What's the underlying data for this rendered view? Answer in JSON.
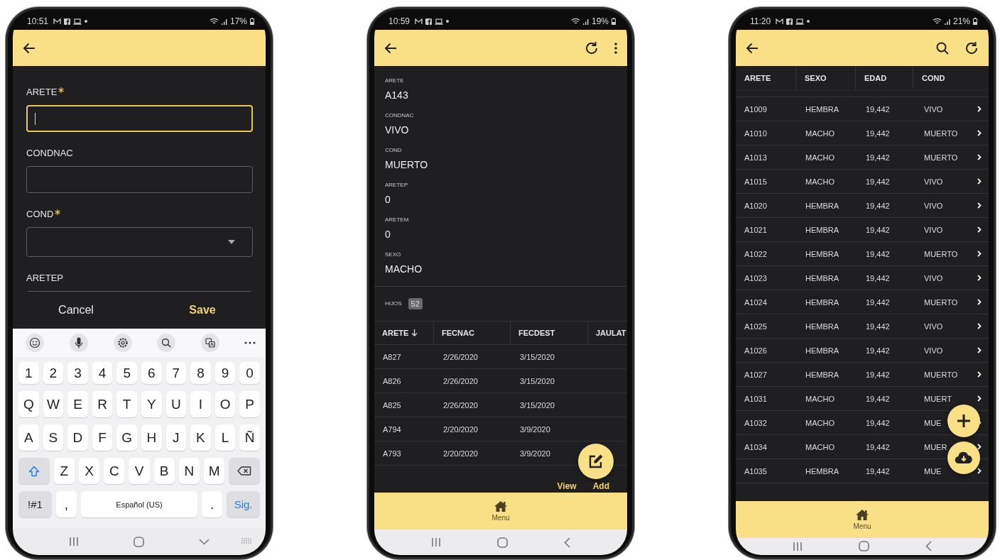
{
  "screens": [
    {
      "kind": "form",
      "status_bar": {
        "time": "10:51",
        "battery": "17%"
      },
      "fields": [
        {
          "label": "ARETE",
          "required": true,
          "kind": "text",
          "focused": true
        },
        {
          "label": "CONDNAC",
          "required": false,
          "kind": "text",
          "focused": false
        },
        {
          "label": "COND",
          "required": true,
          "kind": "select",
          "focused": false
        },
        {
          "label": "ARETEP",
          "required": false,
          "kind": "text",
          "focused": false
        }
      ],
      "actions": [
        {
          "label": "Cancel",
          "kind": "plain"
        },
        {
          "label": "Save",
          "kind": "primary"
        }
      ],
      "keyboard": {
        "number_keys": [
          {
            "label": "1",
            "kind": "char"
          },
          {
            "label": "2",
            "kind": "char"
          },
          {
            "label": "3",
            "kind": "char"
          },
          {
            "label": "4",
            "kind": "char"
          },
          {
            "label": "5",
            "kind": "char"
          },
          {
            "label": "6",
            "kind": "char"
          },
          {
            "label": "7",
            "kind": "char"
          },
          {
            "label": "8",
            "kind": "char"
          },
          {
            "label": "9",
            "kind": "char"
          },
          {
            "label": "0",
            "kind": "char"
          }
        ],
        "letter_rows": [
          [
            {
              "label": "Q",
              "kind": "char"
            },
            {
              "label": "W",
              "kind": "char"
            },
            {
              "label": "E",
              "kind": "char"
            },
            {
              "label": "R",
              "kind": "char"
            },
            {
              "label": "T",
              "kind": "char"
            },
            {
              "label": "Y",
              "kind": "char"
            },
            {
              "label": "U",
              "kind": "char"
            },
            {
              "label": "I",
              "kind": "char"
            },
            {
              "label": "O",
              "kind": "char"
            },
            {
              "label": "P",
              "kind": "char"
            }
          ],
          [
            {
              "label": "A",
              "kind": "char"
            },
            {
              "label": "S",
              "kind": "char"
            },
            {
              "label": "D",
              "kind": "char"
            },
            {
              "label": "F",
              "kind": "char"
            },
            {
              "label": "G",
              "kind": "char"
            },
            {
              "label": "H",
              "kind": "char"
            },
            {
              "label": "J",
              "kind": "char"
            },
            {
              "label": "K",
              "kind": "char"
            },
            {
              "label": "L",
              "kind": "char"
            },
            {
              "label": "Ñ",
              "kind": "char"
            }
          ],
          [
            {
              "kind": "shift"
            },
            {
              "label": "Z",
              "kind": "char"
            },
            {
              "label": "X",
              "kind": "char"
            },
            {
              "label": "C",
              "kind": "char"
            },
            {
              "label": "V",
              "kind": "char"
            },
            {
              "label": "B",
              "kind": "char"
            },
            {
              "label": "N",
              "kind": "char"
            },
            {
              "label": "M",
              "kind": "char"
            },
            {
              "kind": "backspace"
            }
          ]
        ],
        "bottom_keys": [
          {
            "label": "!#1",
            "kind": "function"
          },
          {
            "label": ",",
            "kind": "char"
          },
          {
            "label": "Español (US)",
            "kind": "space"
          },
          {
            "label": ".",
            "kind": "char"
          },
          {
            "label": "Sig.",
            "kind": "action"
          }
        ]
      }
    },
    {
      "kind": "detail",
      "status_bar": {
        "time": "10:59",
        "battery": "19%"
      },
      "details": [
        {
          "label": "ARETE",
          "value": "A143"
        },
        {
          "label": "CONDNAC",
          "value": "VIVO"
        },
        {
          "label": "COND",
          "value": "MUERTO"
        },
        {
          "label": "ARETEP",
          "value": "0"
        },
        {
          "label": "ARETEM",
          "value": "0"
        },
        {
          "label": "SEXO",
          "value": "MACHO"
        }
      ],
      "children_section": {
        "label": "HIJOS",
        "count": "52"
      },
      "table": {
        "columns": [
          {
            "label": "ARETE",
            "sorted": true
          },
          {
            "label": "FECNAC",
            "sorted": false
          },
          {
            "label": "FECDEST",
            "sorted": false
          },
          {
            "label": "JAULAT",
            "sorted": false
          }
        ],
        "rows": [
          [
            "A827",
            "2/26/2020",
            "3/15/2020"
          ],
          [
            "A826",
            "2/26/2020",
            "3/15/2020"
          ],
          [
            "A825",
            "2/26/2020",
            "3/15/2020"
          ],
          [
            "A794",
            "2/20/2020",
            "3/9/2020"
          ],
          [
            "A793",
            "2/20/2020",
            "3/9/2020"
          ]
        ]
      },
      "fab_labels": [
        "View",
        "Add"
      ],
      "bottom_nav": {
        "label": "Menu"
      }
    },
    {
      "kind": "list",
      "status_bar": {
        "time": "11:20",
        "battery": "21%"
      },
      "columns": [
        "ARETE",
        "SEXO",
        "EDAD",
        "COND"
      ],
      "rows": [
        [
          "A1009",
          "HEMBRA",
          "19,442",
          "VIVO"
        ],
        [
          "A1010",
          "MACHO",
          "19,442",
          "MUERTO"
        ],
        [
          "A1013",
          "MACHO",
          "19,442",
          "MUERTO"
        ],
        [
          "A1015",
          "MACHO",
          "19,442",
          "VIVO"
        ],
        [
          "A1020",
          "HEMBRA",
          "19,442",
          "VIVO"
        ],
        [
          "A1021",
          "HEMBRA",
          "19,442",
          "VIVO"
        ],
        [
          "A1022",
          "HEMBRA",
          "19,442",
          "MUERTO"
        ],
        [
          "A1023",
          "HEMBRA",
          "19,442",
          "VIVO"
        ],
        [
          "A1024",
          "HEMBRA",
          "19,442",
          "MUERTO"
        ],
        [
          "A1025",
          "HEMBRA",
          "19,442",
          "VIVO"
        ],
        [
          "A1026",
          "HEMBRA",
          "19,442",
          "VIVO"
        ],
        [
          "A1027",
          "HEMBRA",
          "19,442",
          "MUERTO"
        ],
        [
          "A1031",
          "MACHO",
          "19,442",
          "MUERT"
        ],
        [
          "A1032",
          "MACHO",
          "19,442",
          "MUE"
        ],
        [
          "A1034",
          "MACHO",
          "19,442",
          "MUER"
        ],
        [
          "A1035",
          "HEMBRA",
          "19,442",
          "MUE"
        ]
      ],
      "bottom_nav": {
        "label": "Menu"
      }
    }
  ]
}
